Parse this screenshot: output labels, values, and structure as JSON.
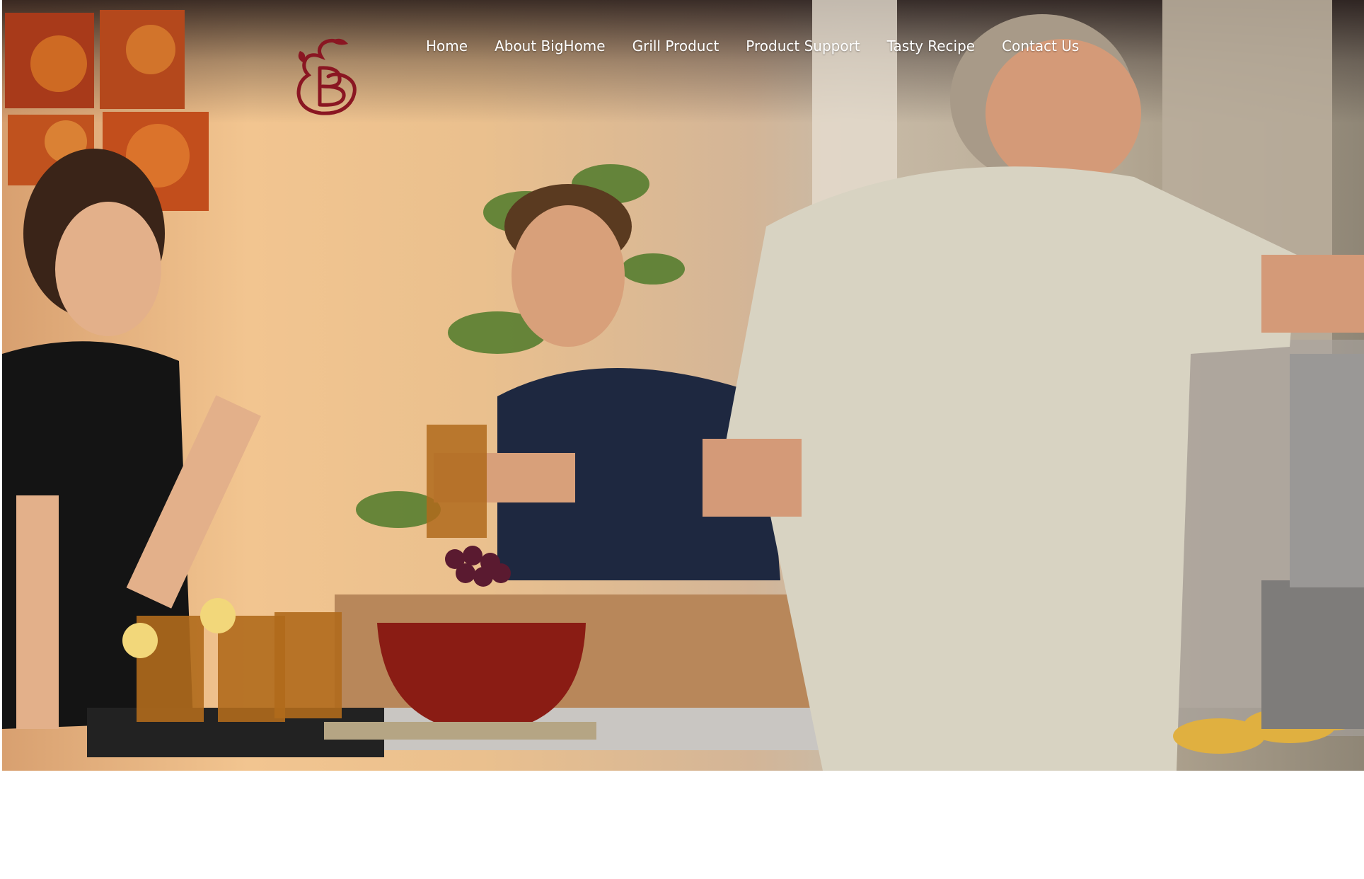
{
  "brand": {
    "logo_icon": "bighome-b-leaf-logo-icon",
    "logo_color": "#8a1622"
  },
  "nav": {
    "items": [
      {
        "label": "Home"
      },
      {
        "label": "About BigHome"
      },
      {
        "label": "Grill Product"
      },
      {
        "label": "Product Support"
      },
      {
        "label": "Tasty Recipe"
      },
      {
        "label": "Contact Us"
      }
    ],
    "text_color": "#ffffff"
  },
  "hero": {
    "image": "hero-photo-outdoor-kitchen-grilling"
  }
}
